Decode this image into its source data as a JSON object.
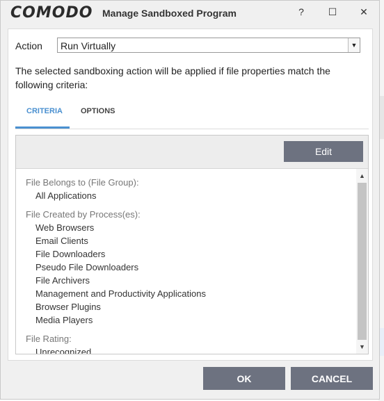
{
  "window": {
    "brand": "COMODO",
    "title": "Manage Sandboxed Program",
    "help_glyph": "?",
    "minimize_glyph": "☐",
    "close_glyph": "✕"
  },
  "action": {
    "label": "Action",
    "selected": "Run Virtually"
  },
  "description": "The selected sandboxing action will be applied if file properties match the following criteria:",
  "tabs": [
    {
      "label": "CRITERIA",
      "active": true
    },
    {
      "label": "OPTIONS",
      "active": false
    }
  ],
  "criteria": {
    "edit_label": "Edit",
    "groups": [
      {
        "header": "File Belongs to (File Group):",
        "items": [
          "All Applications"
        ]
      },
      {
        "header": "File Created by Process(es):",
        "items": [
          "Web Browsers",
          "Email Clients",
          "File Downloaders",
          "Pseudo File Downloaders",
          "File Archivers",
          "Management and Productivity Applications",
          "Browser Plugins",
          "Media Players"
        ]
      },
      {
        "header": "File Rating:",
        "items": [
          "Unrecognized"
        ]
      }
    ]
  },
  "buttons": {
    "ok": "OK",
    "cancel": "CANCEL"
  },
  "colors": {
    "accent": "#4a90d0",
    "button": "#6d7280"
  }
}
